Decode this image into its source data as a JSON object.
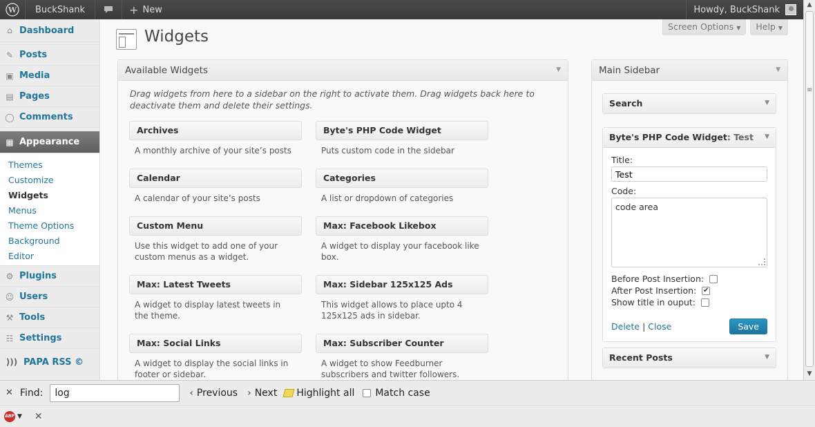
{
  "adminbar": {
    "site_name": "BuckShank",
    "new_label": "New",
    "howdy": "Howdy, BuckShank"
  },
  "menu": {
    "dashboard": "Dashboard",
    "posts": "Posts",
    "media": "Media",
    "pages": "Pages",
    "comments": "Comments",
    "appearance": "Appearance",
    "submenu": [
      "Themes",
      "Customize",
      "Widgets",
      "Menus",
      "Theme Options",
      "Background",
      "Editor"
    ],
    "plugins": "Plugins",
    "users": "Users",
    "tools": "Tools",
    "settings": "Settings",
    "papa_rss": "PAPA RSS ©"
  },
  "screen_meta": {
    "screen_options": "Screen Options",
    "help": "Help"
  },
  "page": {
    "title": "Widgets"
  },
  "available": {
    "heading": "Available Widgets",
    "description": "Drag widgets from here to a sidebar on the right to activate them. Drag widgets back here to deactivate them and delete their settings.",
    "widgets": [
      {
        "title": "Archives",
        "desc": "A monthly archive of your site’s posts"
      },
      {
        "title": "Byte's PHP Code Widget",
        "desc": "Puts custom code in the sidebar"
      },
      {
        "title": "Calendar",
        "desc": "A calendar of your site’s posts"
      },
      {
        "title": "Categories",
        "desc": "A list or dropdown of categories"
      },
      {
        "title": "Custom Menu",
        "desc": "Use this widget to add one of your custom menus as a widget."
      },
      {
        "title": "Max: Facebook Likebox",
        "desc": "A widget to display your facebook like box."
      },
      {
        "title": "Max: Latest Tweets",
        "desc": "A widget to display latest tweets in the theme."
      },
      {
        "title": "Max: Sidebar 125x125 Ads",
        "desc": "This widget allows to place upto 4 125x125 ads in sidebar."
      },
      {
        "title": "Max: Social Links",
        "desc": "A widget to display the social links in footer or sidebar."
      },
      {
        "title": "Max: Subscriber Counter",
        "desc": "A widget to show Feedburner subscribers and twitter followers."
      }
    ]
  },
  "main_sidebar": {
    "heading": "Main Sidebar",
    "search_widget": "Search",
    "php_widget": {
      "name": "Byte's PHP Code Widget",
      "instance_title": ": Test",
      "title_label": "Title:",
      "title_value": "Test",
      "code_label": "Code:",
      "code_value": "code area",
      "before_label": "Before Post Insertion:",
      "before_checked": false,
      "after_label": "After Post Insertion:",
      "after_checked": true,
      "show_title_label": "Show title in ouput:",
      "show_title_checked": false,
      "delete": "Delete",
      "separator": "|",
      "close": "Close",
      "save": "Save"
    },
    "recent_posts": "Recent Posts"
  },
  "findbar": {
    "find_label": "Find:",
    "query": "log",
    "previous": "Previous",
    "next": "Next",
    "highlight_all": "Highlight all",
    "match_case": "Match case"
  },
  "colors": {
    "link": "#21759b",
    "adminbar": "#464646",
    "save_button": "#21759b"
  }
}
